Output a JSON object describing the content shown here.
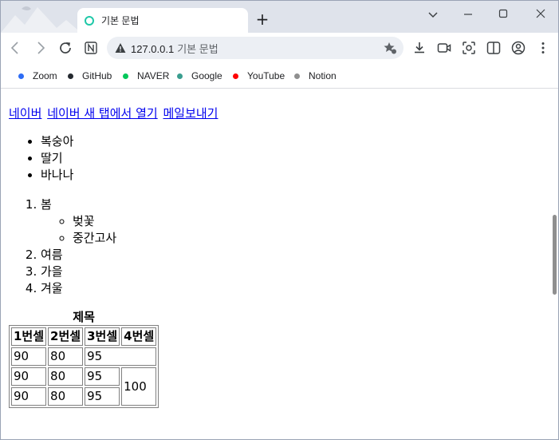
{
  "tab": {
    "title": "기본 문법"
  },
  "omnibox": {
    "host": "127.0.0.1",
    "page": "기본 문법"
  },
  "bookmarks": [
    {
      "label": "Zoom",
      "color": "#2d6cf5"
    },
    {
      "label": "GitHub",
      "color": "#24292f"
    },
    {
      "label": "NAVER",
      "color": "#03c75a"
    },
    {
      "label": "Google",
      "color": "#3a9e8f"
    },
    {
      "label": "YouTube",
      "color": "#ff0000"
    },
    {
      "label": "Notion",
      "color": "#8f8f8f"
    }
  ],
  "links": [
    "네이버",
    "네이버 새 탭에서 열기",
    "메일보내기"
  ],
  "fruits": [
    "복숭아",
    "딸기",
    "바나나"
  ],
  "seasons": {
    "spring": "봄",
    "spring_sub": [
      "벚꽃",
      "중간고사"
    ],
    "others": [
      "여름",
      "가을",
      "겨울"
    ]
  },
  "table": {
    "caption": "제목",
    "headers": [
      "1번셀",
      "2번셀",
      "3번셀",
      "4번셀"
    ],
    "row1": [
      "90",
      "80",
      "95"
    ],
    "row2": [
      "90",
      "80",
      "95",
      "100"
    ],
    "row3": [
      "90",
      "80",
      "95"
    ]
  }
}
